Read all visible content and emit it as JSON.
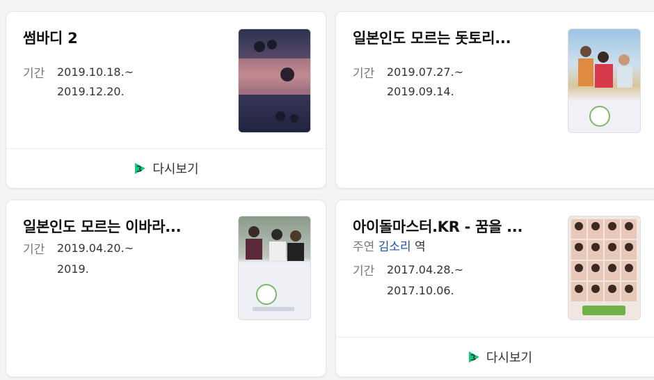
{
  "cards": [
    {
      "title": "썸바디 2",
      "period_label": "기간",
      "start": "2019.10.18.~",
      "end": "2019.12.20.",
      "rewatch": "다시보기"
    },
    {
      "title": "일본인도 모르는 돗토리...",
      "period_label": "기간",
      "start": "2019.07.27.~",
      "end": "2019.09.14."
    },
    {
      "title": "일본인도 모르는 이바라...",
      "period_label": "기간",
      "start": "2019.04.20.~",
      "end": "2019."
    },
    {
      "title": "아이돌마스터.KR - 꿈을 ...",
      "cast_label": "주연",
      "cast_name": "김소리",
      "cast_role": "역",
      "period_label": "기간",
      "start": "2017.04.28.~",
      "end": "2017.10.06.",
      "rewatch": "다시보기"
    }
  ],
  "colors": {
    "brand_green": "#19c37d",
    "link_blue": "#1a4fb4"
  }
}
